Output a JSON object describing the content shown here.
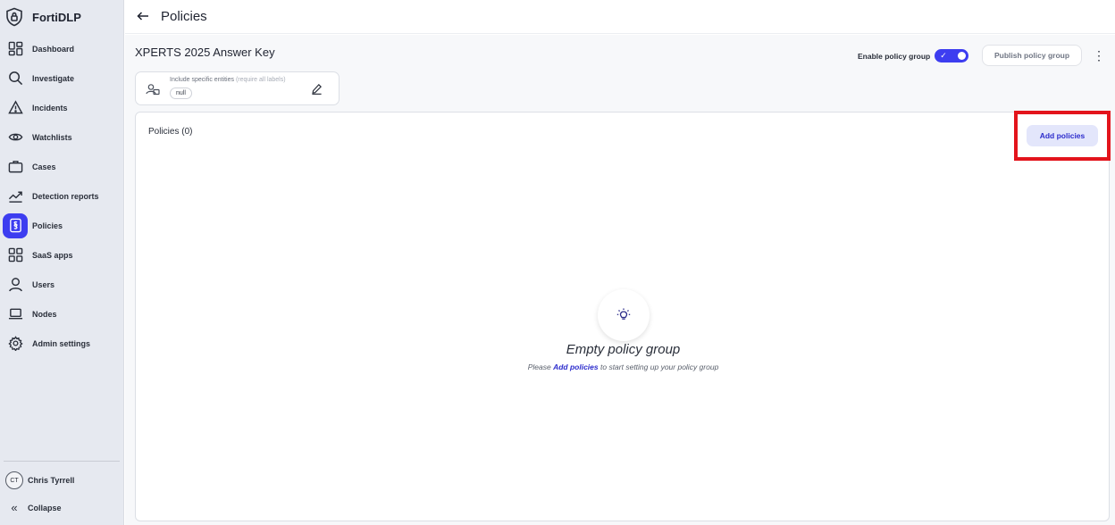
{
  "app": {
    "name": "FortiDLP",
    "logo_icon": "shield-lock-icon"
  },
  "sidebar": {
    "items": [
      {
        "label": "Dashboard",
        "icon": "dashboard-grid-icon"
      },
      {
        "label": "Investigate",
        "icon": "search-icon"
      },
      {
        "label": "Incidents",
        "icon": "warning-triangle-icon"
      },
      {
        "label": "Watchlists",
        "icon": "eye-icon"
      },
      {
        "label": "Cases",
        "icon": "briefcase-icon"
      },
      {
        "label": "Detection reports",
        "icon": "trend-chart-icon"
      },
      {
        "label": "Policies",
        "icon": "policy-document-icon",
        "active": true
      },
      {
        "label": "SaaS apps",
        "icon": "apps-grid-icon"
      },
      {
        "label": "Users",
        "icon": "user-icon"
      },
      {
        "label": "Nodes",
        "icon": "laptop-icon"
      },
      {
        "label": "Admin settings",
        "icon": "gear-icon"
      }
    ],
    "user": {
      "initials": "CT",
      "name": "Chris Tyrrell"
    },
    "collapse_label": "Collapse"
  },
  "header": {
    "title": "Policies"
  },
  "group": {
    "title": "XPERTS 2025 Answer Key",
    "enable_label": "Enable policy group",
    "enabled": true,
    "publish_label": "Publish policy group",
    "entities": {
      "label": "Include specific entities",
      "hint": "(require all labels)",
      "chip": "null"
    }
  },
  "policies": {
    "title": "Policies (0)",
    "add_label": "Add policies",
    "empty_title": "Empty policy group",
    "empty_prefix": "Please",
    "empty_link": "Add policies",
    "empty_suffix": "to start setting up your policy group"
  },
  "colors": {
    "accent": "#3d3df0",
    "highlight": "#e3141c",
    "sidebar_bg": "#e6e9f0"
  }
}
